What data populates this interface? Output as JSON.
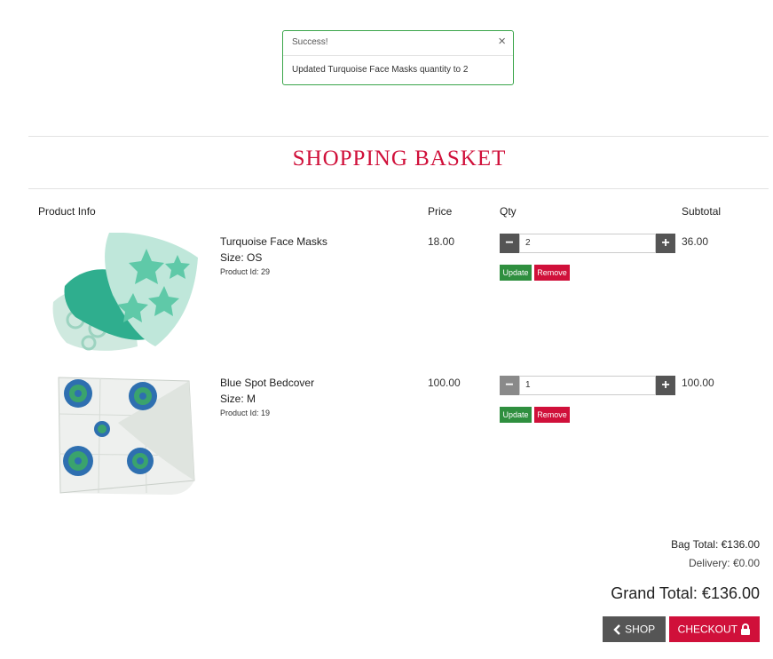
{
  "toast": {
    "title": "Success!",
    "close": "×",
    "message": "Updated Turquoise Face Masks quantity to 2"
  },
  "page": {
    "title": "SHOPPING BASKET"
  },
  "table": {
    "headers": {
      "product": "Product Info",
      "price": "Price",
      "qty": "Qty",
      "subtotal": "Subtotal"
    },
    "rows": [
      {
        "name": "Turquoise Face Masks",
        "size": "Size: OS",
        "product_id": "Product Id: 29",
        "price": "18.00",
        "qty": "2",
        "subtotal": "36.00"
      },
      {
        "name": "Blue Spot Bedcover",
        "size": "Size: M",
        "product_id": "Product Id: 19",
        "price": "100.00",
        "qty": "1",
        "subtotal": "100.00"
      }
    ],
    "buttons": {
      "update": "Update",
      "remove": "Remove",
      "minus": "−",
      "plus": "+"
    }
  },
  "totals": {
    "bag_total": "Bag Total: €136.00",
    "delivery": "Delivery: €0.00",
    "grand_total": "Grand Total: €136.00"
  },
  "actions": {
    "shop": "SHOP",
    "checkout": "CHECKOUT"
  },
  "colors": {
    "brand": "#d0103a",
    "success": "#2f8f3f",
    "dark": "#555555"
  },
  "icons": {
    "shop": "chevron-left-icon",
    "checkout": "lock-icon"
  }
}
